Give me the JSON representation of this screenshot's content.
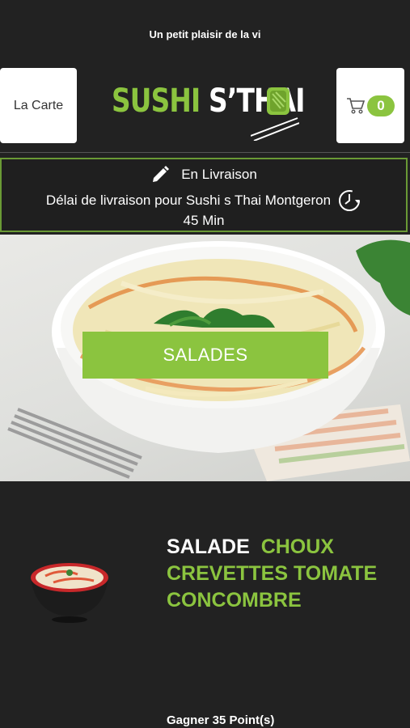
{
  "header": {
    "tagline": "Un petit plaisir de la vi",
    "carte_label": "La Carte",
    "cart_count": "0",
    "logo_text_green": "SUSHI",
    "logo_text_white": "S’THAI"
  },
  "delivery": {
    "mode": "En Livraison",
    "delay_text": "Délai de livraison pour Sushi s Thai Montgeron",
    "duration": "45 Min"
  },
  "hero": {
    "category_label": "SALADES"
  },
  "product": {
    "title_white": "SALADE",
    "title_green_1": "CHOUX",
    "title_green_2": "CREVETTES TOMATE",
    "title_green_3": "CONCOMBRE",
    "points": "Gagner 35 Point(s)"
  },
  "colors": {
    "accent": "#8bc43f",
    "background": "#222222"
  },
  "icons": [
    "pencil-icon",
    "clock-icon",
    "cart-icon",
    "logo-icon"
  ]
}
